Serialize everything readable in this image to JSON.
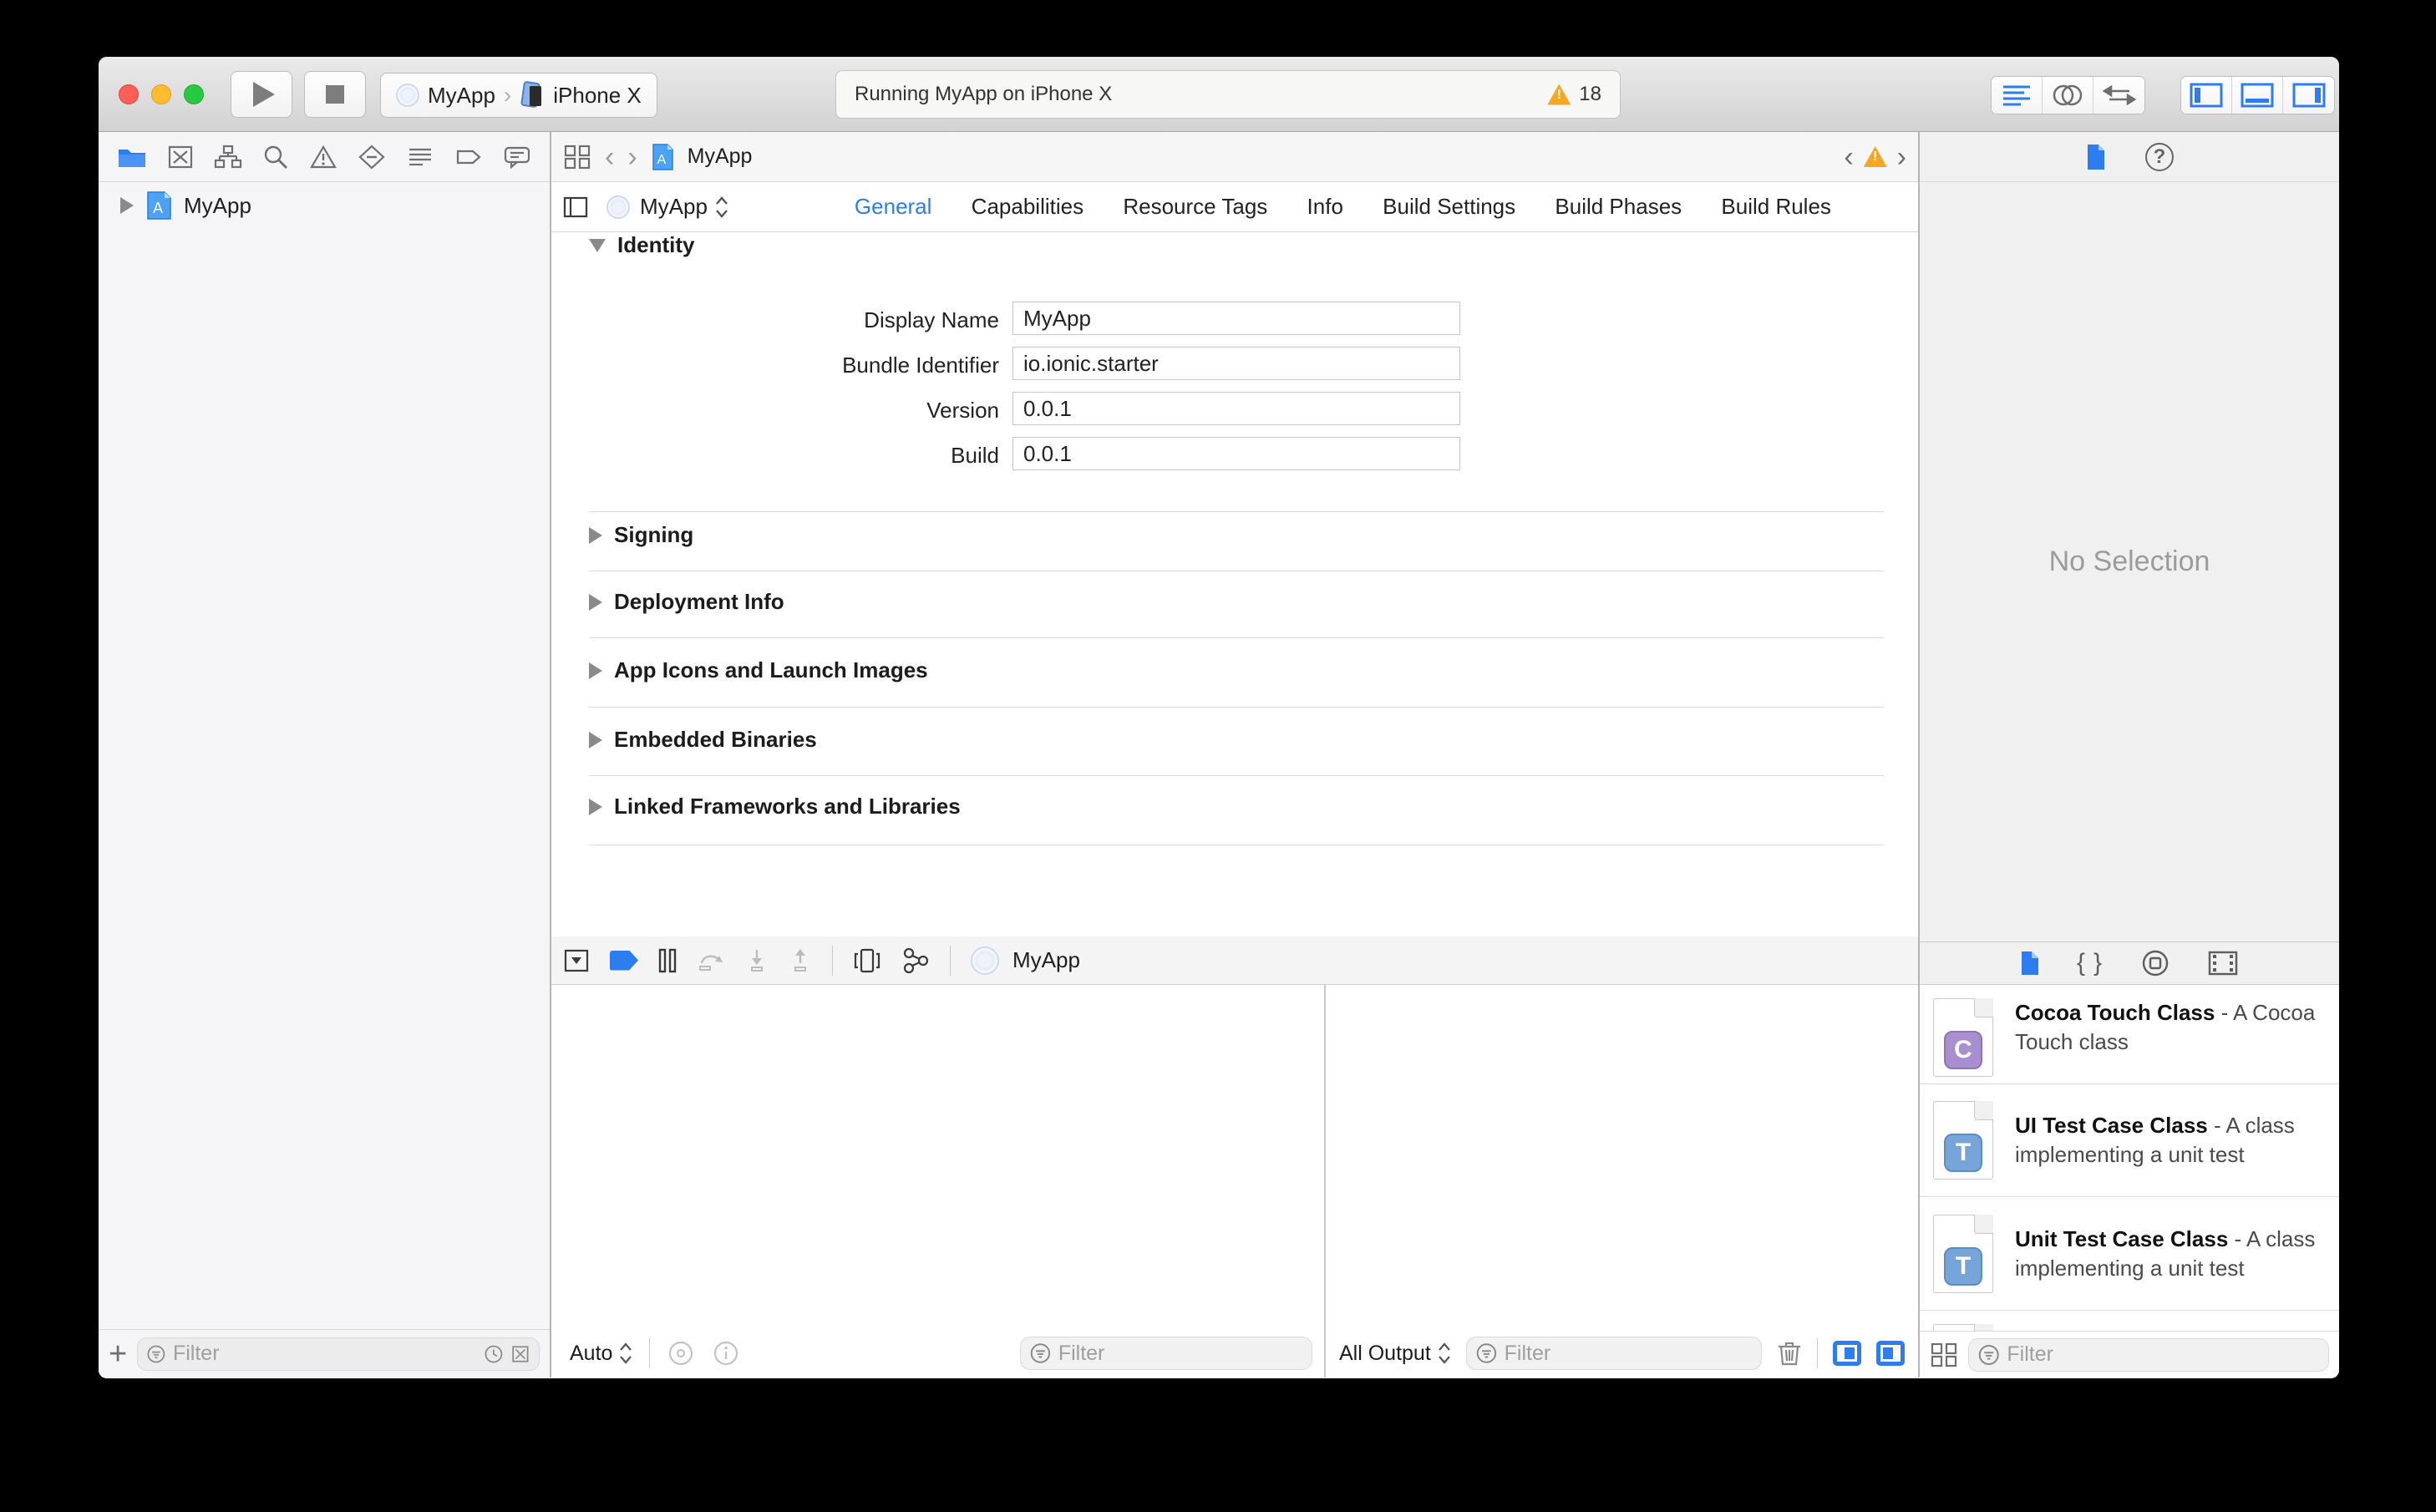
{
  "colors": {
    "accent": "#2D7CF0",
    "warning_orange": "#F5A623",
    "tab_active_blue": "#2D7CF0"
  },
  "toolbar": {
    "scheme_target": "MyApp",
    "scheme_device": "iPhone X",
    "status_text": "Running MyApp on iPhone X",
    "warning_count": "18"
  },
  "navigator": {
    "project_name": "MyApp",
    "filter_placeholder": "Filter"
  },
  "jumpbar": {
    "item": "MyApp"
  },
  "editor": {
    "target_popup": "MyApp",
    "tabs": [
      "General",
      "Capabilities",
      "Resource Tags",
      "Info",
      "Build Settings",
      "Build Phases",
      "Build Rules"
    ],
    "identity": {
      "title": "Identity",
      "fields": [
        {
          "label": "Display Name",
          "value": "MyApp"
        },
        {
          "label": "Bundle Identifier",
          "value": "io.ionic.starter"
        },
        {
          "label": "Version",
          "value": "0.0.1"
        },
        {
          "label": "Build",
          "value": "0.0.1"
        }
      ]
    },
    "sections": [
      "Signing",
      "Deployment Info",
      "App Icons and Launch Images",
      "Embedded Binaries",
      "Linked Frameworks and Libraries"
    ]
  },
  "debug": {
    "target_name": "MyApp",
    "variables_scope": "Auto",
    "output_scope": "All Output",
    "variables_filter_placeholder": "Filter",
    "console_filter_placeholder": "Filter"
  },
  "inspector": {
    "empty_state": "No Selection",
    "filter_placeholder": "Filter"
  },
  "library": {
    "items": [
      {
        "badge": "C",
        "title": "Cocoa Touch Class",
        "desc": "- A Cocoa Touch class"
      },
      {
        "badge": "T",
        "title": "UI Test Case Class",
        "desc": "- A class implementing a unit test"
      },
      {
        "badge": "T",
        "title": "Unit Test Case Class",
        "desc": "- A class implementing a unit test"
      }
    ]
  }
}
